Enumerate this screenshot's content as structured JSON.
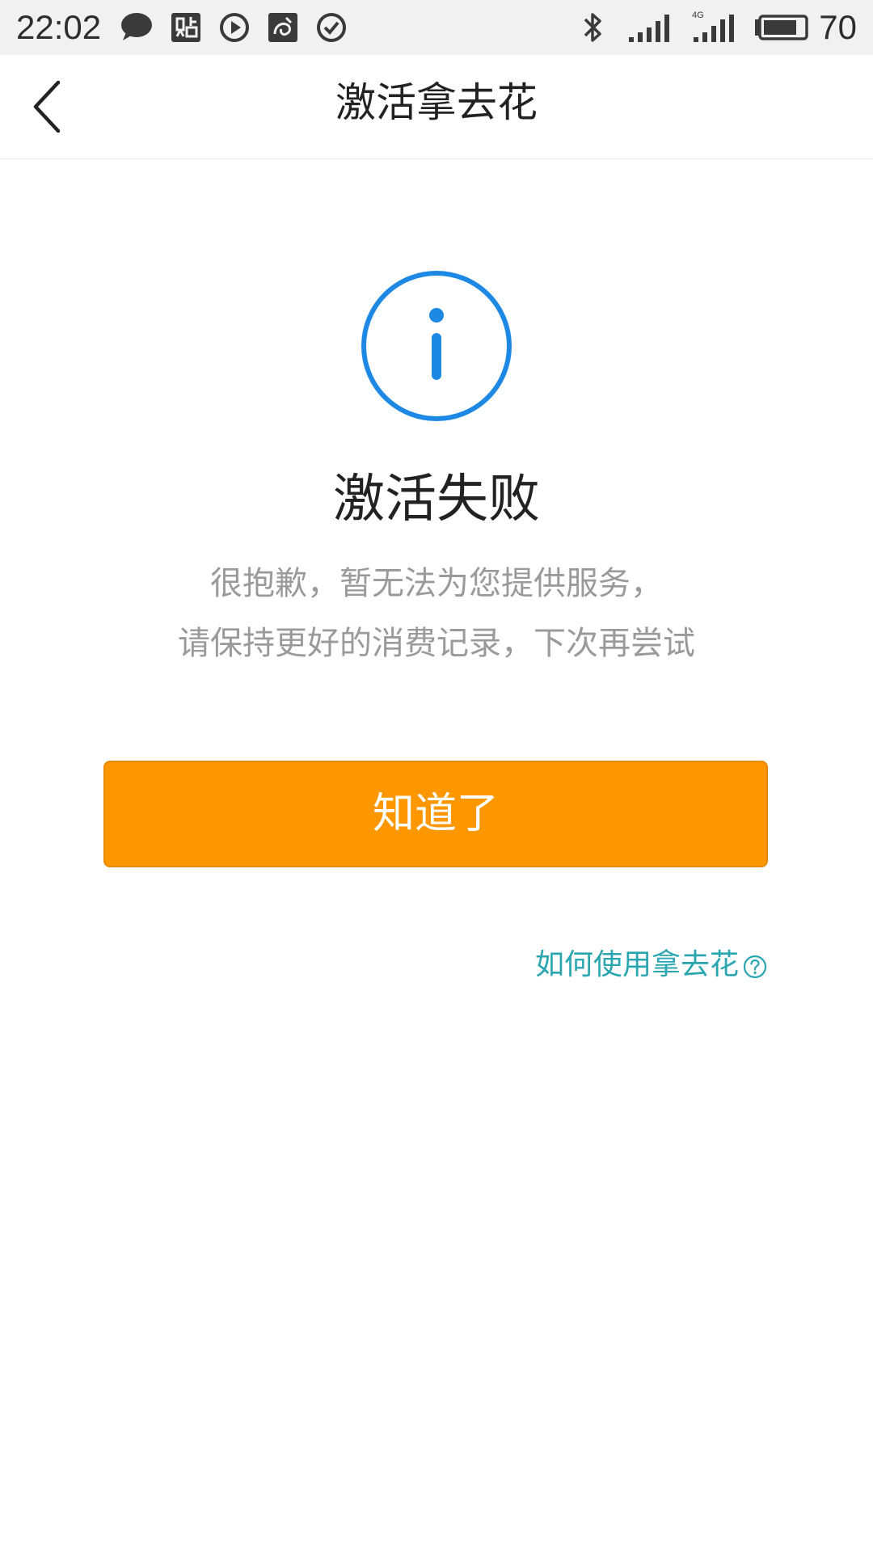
{
  "status_bar": {
    "time": "22:02",
    "battery_level": "70",
    "icons_left": [
      "message-icon",
      "tieba-icon",
      "play-icon",
      "uc-browser-icon",
      "check-circle-icon"
    ],
    "icons_right": [
      "bluetooth-icon",
      "signal-icon",
      "signal-4g-icon",
      "battery-icon"
    ],
    "network_label": "4G"
  },
  "nav": {
    "title": "激活拿去花",
    "back_icon": "chevron-left-icon"
  },
  "result": {
    "icon": "info-circle-icon",
    "title": "激活失败",
    "message_line1": "很抱歉，暂无法为您提供服务，",
    "message_line2": "请保持更好的消费记录，下次再尝试"
  },
  "actions": {
    "confirm_label": "知道了",
    "help_link_label": "如何使用拿去花",
    "help_icon": "question-circle-icon"
  },
  "colors": {
    "accent_blue": "#1e88e5",
    "button_orange": "#fd9700",
    "link_teal": "#2aa6b0",
    "message_gray": "#9a9a9a"
  }
}
